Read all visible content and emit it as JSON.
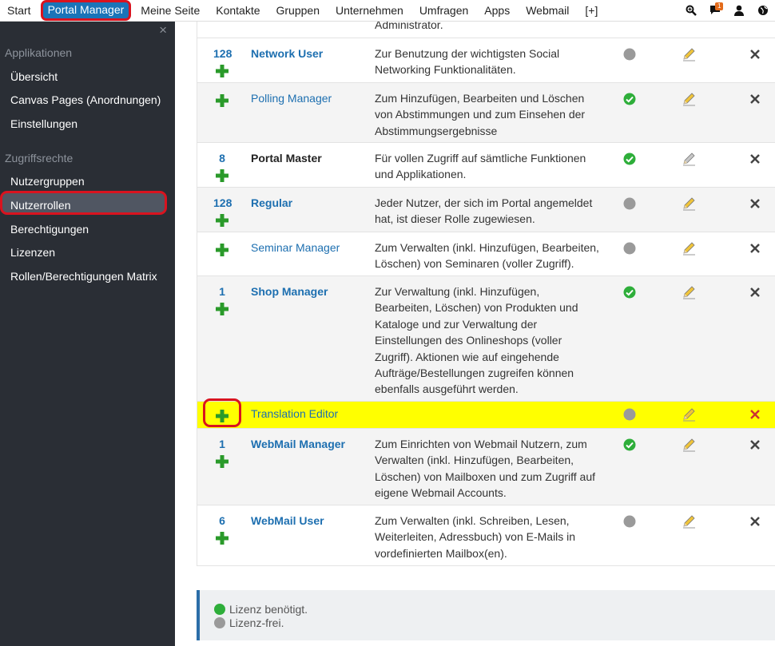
{
  "nav": {
    "items": [
      "Start",
      "Portal Manager",
      "Meine Seite",
      "Kontakte",
      "Gruppen",
      "Unternehmen",
      "Umfragen",
      "Apps",
      "Webmail",
      "[+]"
    ],
    "active_index": 1,
    "notification_count": "1"
  },
  "sidebar": {
    "close_label": "×",
    "section_apps": "Applikationen",
    "apps_items": [
      "Übersicht",
      "Canvas Pages (Anordnungen)",
      "Einstellungen"
    ],
    "section_access": "Zugriffsrechte",
    "access_items": [
      "Nutzergruppen",
      "Nutzerrollen",
      "Berechtigungen",
      "Lizenzen",
      "Rollen/Berechtigungen Matrix"
    ],
    "selected_item": "Nutzerrollen"
  },
  "table": {
    "top_fragment": "Administrator.",
    "rows": [
      {
        "count": "128",
        "name": "Network User",
        "bold": true,
        "desc_lines": [
          "Zur Benutzung der wichtigsten Social",
          "Networking Funktionalitäten."
        ],
        "status": "grey",
        "edit": "pencil-yellow"
      },
      {
        "count": "",
        "name": "Polling Manager",
        "bold": false,
        "desc_lines": [
          "Zum Hinzufügen, Bearbeiten und Löschen",
          "von Abstimmungen und zum Einsehen der",
          "Abstimmungsergebnisse"
        ],
        "status": "green",
        "edit": "pencil-yellow"
      },
      {
        "count": "8",
        "name": "Portal Master",
        "bold": true,
        "dark": true,
        "desc_lines": [
          "Für vollen Zugriff auf sämtliche Funktionen",
          "und Applikationen."
        ],
        "status": "green",
        "edit": "pencil-grey"
      },
      {
        "count": "128",
        "name": "Regular",
        "bold": true,
        "desc_lines": [
          "Jeder Nutzer, der sich im Portal angemeldet",
          "hat, ist dieser Rolle zugewiesen."
        ],
        "status": "grey",
        "edit": "pencil-yellow"
      },
      {
        "count": "",
        "name": "Seminar Manager",
        "bold": false,
        "desc_lines": [
          "Zum Verwalten (inkl. Hinzufügen, Bearbeiten,",
          "Löschen) von Seminaren (voller Zugriff)."
        ],
        "status": "grey",
        "edit": "pencil-yellow"
      },
      {
        "count": "1",
        "name": "Shop Manager",
        "bold": true,
        "desc_lines": [
          "Zur Verwaltung (inkl. Hinzufügen,",
          "Bearbeiten, Löschen) von Produkten und",
          "Kataloge und zur Verwaltung der",
          "Einstellungen des Onlineshops (voller",
          "Zugriff). Aktionen wie auf eingehende",
          "Aufträge/Bestellungen zugreifen können",
          "ebenfalls ausgeführt werden."
        ],
        "status": "green",
        "edit": "pencil-yellow"
      },
      {
        "count": "",
        "name": "Translation Editor",
        "bold": false,
        "desc_lines": [],
        "status": "grey",
        "edit": "pencil-yellow",
        "highlight": true
      },
      {
        "count": "1",
        "name": "WebMail Manager",
        "bold": true,
        "desc_lines": [
          "Zum Einrichten von Webmail Nutzern, zum",
          "Verwalten (inkl. Hinzufügen, Bearbeiten,",
          "Löschen) von Mailboxen und zum Zugriff auf",
          "eigene Webmail Accounts."
        ],
        "status": "green",
        "edit": "pencil-yellow"
      },
      {
        "count": "6",
        "name": "WebMail User",
        "bold": true,
        "desc_lines": [
          "Zum Verwalten (inkl. Schreiben, Lesen,",
          "Weiterleiten, Adressbuch) von E-Mails in",
          "vordefinierten Mailbox(en)."
        ],
        "status": "grey",
        "edit": "pencil-yellow"
      }
    ]
  },
  "legend": {
    "licensed": "Lizenz benötigt.",
    "free": "Lizenz-frei."
  },
  "colors": {
    "accent": "#1a74b8",
    "highlight_ring": "#d9131f",
    "sidebar_bg": "#2a2e35",
    "status_green": "#2eae3a",
    "status_grey": "#9a9a9a",
    "row_highlight": "#ffff00"
  }
}
